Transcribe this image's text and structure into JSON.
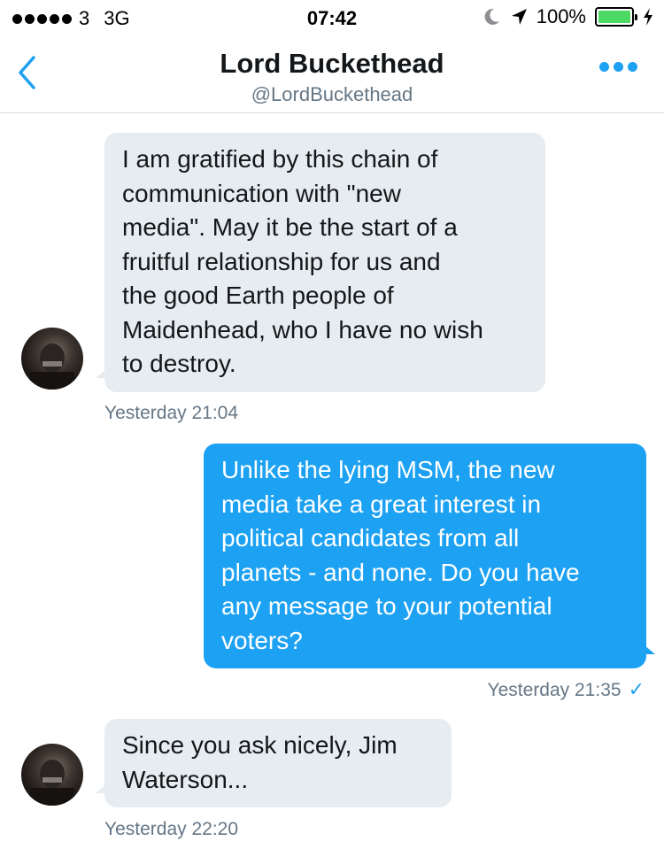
{
  "status_bar": {
    "carrier": "3",
    "network": "3G",
    "time": "07:42",
    "battery": "100%",
    "battery_level": 1.0,
    "icons": [
      "signal-dots-icon",
      "moon-icon",
      "location-arrow-icon",
      "battery-icon",
      "charging-bolt-icon"
    ]
  },
  "header": {
    "name": "Lord Buckethead",
    "handle": "@LordBuckethead",
    "icons": [
      "chevron-left-icon",
      "more-dots-icon"
    ]
  },
  "messages": [
    {
      "direction": "incoming",
      "text": "I am gratified by this chain of\ncommunication with \"new\nmedia\". May it be the start of a\nfruitful relationship for us and\nthe good Earth people of\nMaidenhead, who I have no wish\nto destroy.",
      "timestamp": "Yesterday 21:04"
    },
    {
      "direction": "outgoing",
      "text": "Unlike the lying MSM, the new\nmedia take a great interest in\npolitical candidates from all\nplanets - and none. Do you have\nany message to your potential\nvoters?",
      "timestamp": "Yesterday 21:35",
      "read_receipt": "✓"
    },
    {
      "direction": "incoming",
      "text": "Since you ask nicely, Jim\nWaterson...",
      "timestamp": "Yesterday 22:20"
    }
  ],
  "colors": {
    "accent": "#1da1f2",
    "incoming_bubble": "#e6ecf0",
    "secondary_text": "#657786",
    "battery_green": "#4cd964"
  }
}
